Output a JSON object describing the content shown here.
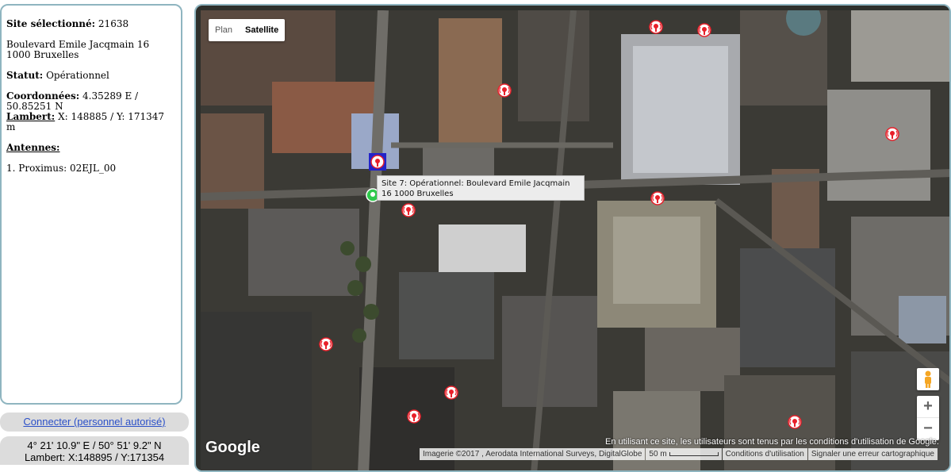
{
  "info": {
    "site_label": "Site sélectionné:",
    "site_id": "21638",
    "address_line1": "Boulevard Emile Jacqmain 16",
    "address_line2": "1000 Bruxelles",
    "status_label": "Statut:",
    "status_value": "Opérationnel",
    "coords_label": "Coordonnées:",
    "coords_value": "4.35289 E / 50.85251 N",
    "lambert_label": "Lambert:",
    "lambert_value": "X: 148885 / Y: 171347 m",
    "antennas_label": "Antennes:",
    "antennas": [
      "1. Proximus: 02EJL_00"
    ]
  },
  "connect_label": "Connecter (personnel autorisé)",
  "cursor_coords": {
    "line1": "4° 21' 10.9\" E / 50° 51' 9.2\" N",
    "line2": "Lambert: X:148895 / Y:171354"
  },
  "map": {
    "type_plan": "Plan",
    "type_satellite": "Satellite",
    "tooltip_line1": "Site 7: Opérationnel: Boulevard Emile Jacqmain",
    "tooltip_line2": "16 1000 Bruxelles",
    "google_logo": "Google",
    "terms_notice": "En utilisant ce site, les utilisateurs sont tenus par les conditions d'utilisation de Google.",
    "imagery": "Imagerie ©2017 , Aerodata International Surveys, DigitalGlobe",
    "scale": "50 m",
    "terms_link": "Conditions d'utilisation",
    "report_link": "Signaler une erreur cartographique",
    "zoom_in": "+",
    "zoom_out": "−",
    "colors": {
      "marker_red": "#e8202a",
      "selected_blue": "#2323c8",
      "marker_green": "#2fc94c"
    }
  }
}
